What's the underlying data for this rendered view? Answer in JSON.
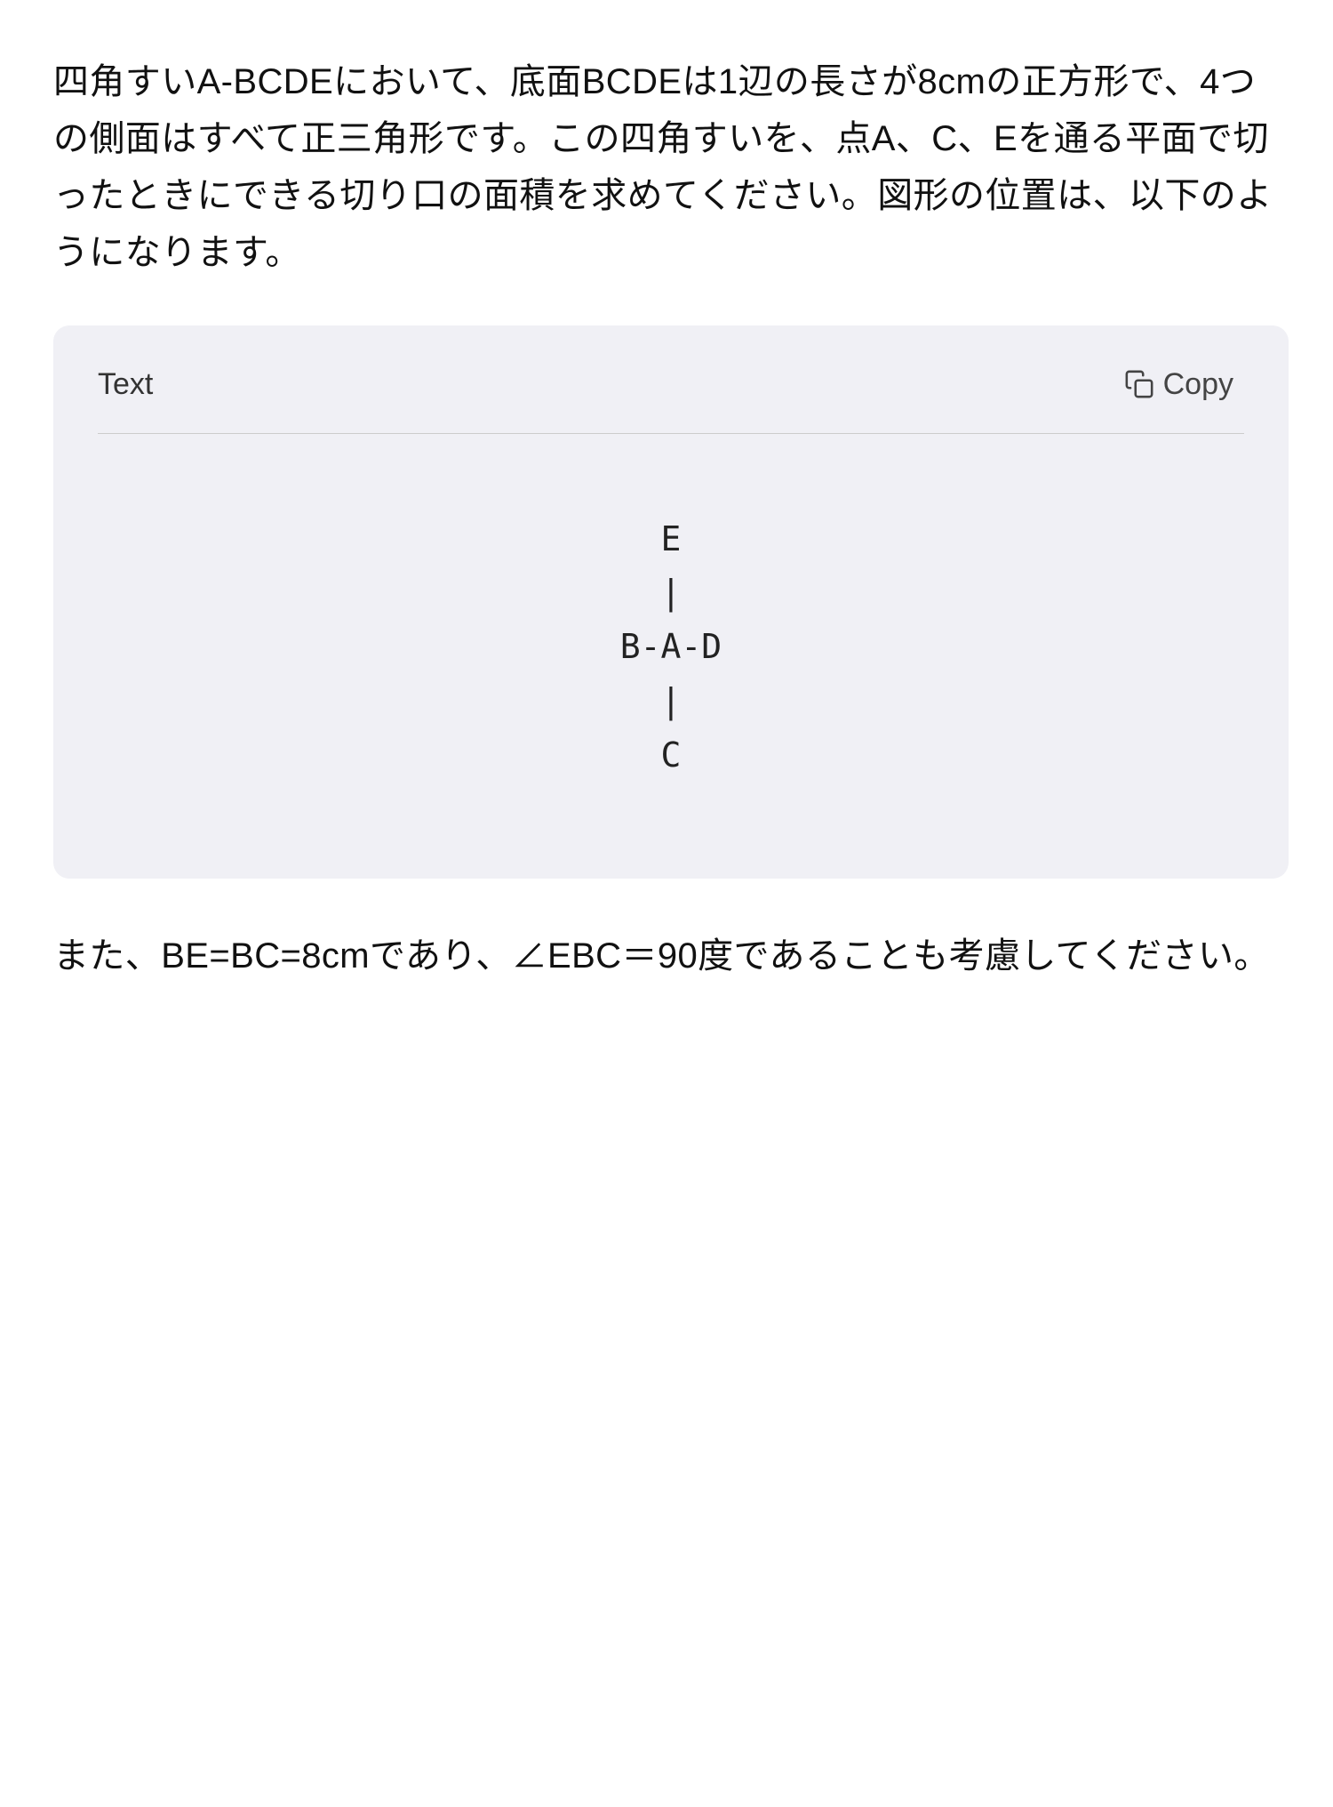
{
  "main_text": "四角すいA-BCDEにおいて、底面BCDEは1辺の長さが8cmの正方形で、4つの側面はすべて正三角形です。この四角すいを、点A、C、Eを通る平面で切ったときにできる切り口の面積を求めてください。図形の位置は、以下のようになります。",
  "code_block": {
    "label": "Text",
    "copy_button_label": "Copy",
    "copy_icon_name": "copy-icon",
    "diagram": {
      "top_label": "E",
      "top_bar": "|",
      "middle_label": "B-A-D",
      "bottom_bar": "|",
      "bottom_label": "C"
    }
  },
  "bottom_text": "また、BE=BC=8cmであり、∠EBC＝90度であることも考慮してください。"
}
